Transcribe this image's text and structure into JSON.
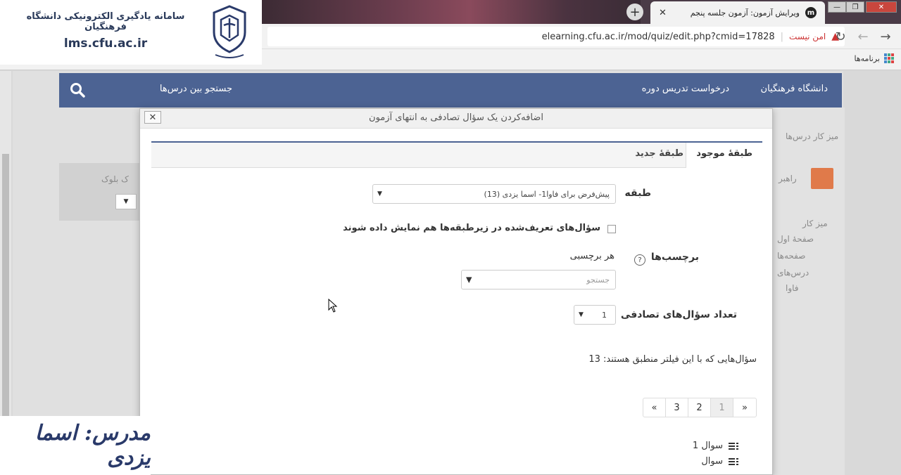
{
  "browser": {
    "tab_title": "ویرایش آزمون: آزمون جلسه پنجم",
    "tab_favicon": "m",
    "tab_close": "✕",
    "new_tab": "+",
    "security_label": "امن نیست",
    "url": "elearning.cfu.ac.ir/mod/quiz/edit.php?cmid=17828",
    "bookmarks_label": "برنامه‌ها",
    "win_min": "—",
    "win_max": "❐",
    "win_close": "✕"
  },
  "brand": {
    "title": "سامانه یادگیری الکترونیکی دانشگاه فرهنگیان",
    "domain": "lms.cfu.ac.ir"
  },
  "site_nav": {
    "home": "دانشگاه فرهنگیان",
    "request": "درخواست تدریس دوره",
    "search": "جستجو بین درس‌ها"
  },
  "background": {
    "breadcrumb": "میز کار  درس‌ها",
    "block_title": "راهبر",
    "add_block": "ک بلوک",
    "nav_items": [
      "میز کار",
      "صفحهٔ اول",
      "صفحه‌ها",
      "درس‌های",
      "فاوا"
    ]
  },
  "modal": {
    "title": "اضافه‌کردن یک سؤال تصادفی به انتهای آزمون",
    "close": "✕",
    "tabs": {
      "existing": "طبقهٔ موجود",
      "new": "طبقهٔ جدید"
    },
    "category_label": "طبقه",
    "category_value": "پیش‌فرض برای فاوا1- اسما یزدی (13)",
    "subcategories_label": "سؤال‌های تعریف‌شده در زیرطبقه‌ها هم نمایش داده شوند",
    "tags_label": "برچسب‌ها",
    "tags_help": "?",
    "tags_any": "هر برچسبی",
    "tags_search_placeholder": "جستجو",
    "count_label": "تعداد سؤال‌های تصادفی",
    "count_value": "1",
    "matching_text": "سؤال‌هایی که با این فیلتر منطبق هستند: 13",
    "pager": [
      "«",
      "1",
      "2",
      "3",
      "»"
    ],
    "questions": [
      "سوال 1",
      "سوال"
    ]
  },
  "instructor": "مدرس: اسما یزدی"
}
